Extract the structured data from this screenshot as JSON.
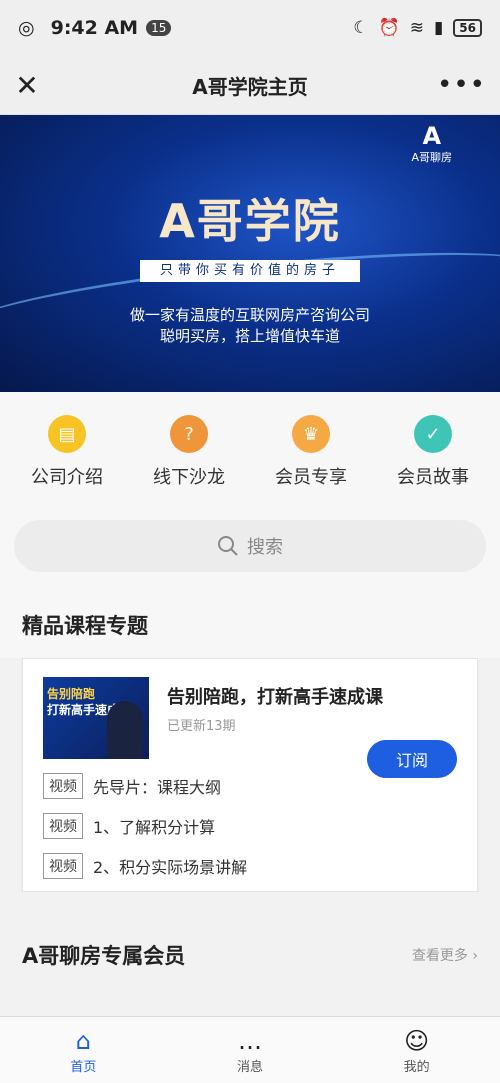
{
  "status_bar": {
    "time": "9:42 AM",
    "badge": "15",
    "battery": "56"
  },
  "nav": {
    "title": "A哥学院主页",
    "close_icon": "close-icon",
    "more_icon": "more-icon"
  },
  "banner": {
    "logo_text": "A哥聊房",
    "brand": "A哥学院",
    "slogan": "只带你买有价值的房子",
    "desc_line1": "做一家有温度的互联网房产咨询公司",
    "desc_line2": "聪明买房，搭上增值快车道"
  },
  "icons": [
    {
      "label": "公司介绍",
      "color": "#f7c325",
      "glyph": "▤"
    },
    {
      "label": "线下沙龙",
      "color": "#f0953a",
      "glyph": "?"
    },
    {
      "label": "会员专享",
      "color": "#f5a944",
      "glyph": "♛"
    },
    {
      "label": "会员故事",
      "color": "#3ec5b5",
      "glyph": "✓"
    }
  ],
  "search": {
    "placeholder": "搜索"
  },
  "section_course": {
    "title": "精品课程专题"
  },
  "course": {
    "thumb_line1": "告别陪跑",
    "thumb_line2": "打新高手速成课",
    "title": "告别陪跑，打新高手速成课",
    "updated": "已更新13期",
    "subscribe_label": "订阅",
    "lessons": [
      {
        "tag": "视频",
        "text": "先导片：课程大纲"
      },
      {
        "tag": "视频",
        "text": "1、了解积分计算"
      },
      {
        "tag": "视频",
        "text": "2、积分实际场景讲解"
      }
    ]
  },
  "section_member": {
    "title": "A哥聊房专属会员",
    "see_more": "查看更多"
  },
  "tabs": [
    {
      "label": "首页",
      "icon": "home-icon",
      "active": true
    },
    {
      "label": "消息",
      "icon": "message-icon",
      "active": false
    },
    {
      "label": "我的",
      "icon": "profile-icon",
      "active": false
    }
  ]
}
